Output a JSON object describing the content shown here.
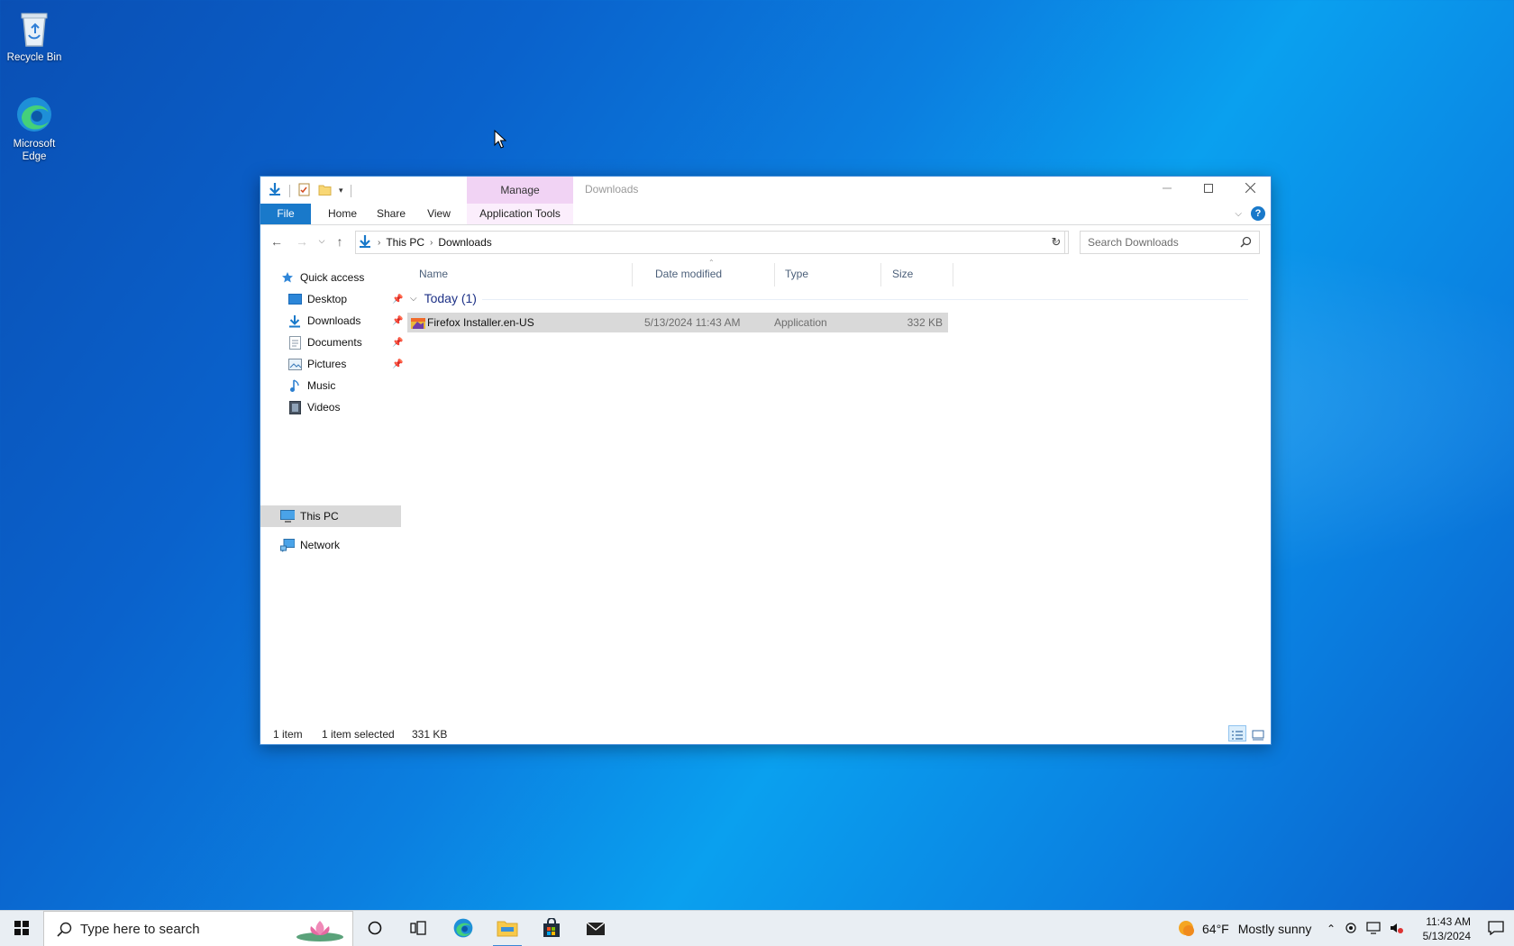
{
  "desktop": {
    "icons": [
      {
        "label": "Recycle Bin",
        "icon": "recycle-bin-icon"
      },
      {
        "label": "Microsoft Edge",
        "icon": "edge-icon"
      }
    ]
  },
  "window": {
    "title": "Downloads",
    "contextual_tab_group": "Manage",
    "tabs": [
      {
        "label": "File"
      },
      {
        "label": "Home"
      },
      {
        "label": "Share"
      },
      {
        "label": "View"
      },
      {
        "label": "Application Tools"
      }
    ],
    "address": {
      "crumbs": [
        "This PC",
        "Downloads"
      ]
    },
    "search": {
      "placeholder": "Search Downloads"
    },
    "nav": {
      "quick_access": "Quick access",
      "items": [
        {
          "label": "Desktop",
          "pinned": true,
          "icon": "desktop-folder-icon"
        },
        {
          "label": "Downloads",
          "pinned": true,
          "icon": "downloads-folder-icon"
        },
        {
          "label": "Documents",
          "pinned": true,
          "icon": "documents-folder-icon"
        },
        {
          "label": "Pictures",
          "pinned": true,
          "icon": "pictures-folder-icon"
        },
        {
          "label": "Music",
          "pinned": false,
          "icon": "music-folder-icon"
        },
        {
          "label": "Videos",
          "pinned": false,
          "icon": "videos-folder-icon"
        }
      ],
      "this_pc": "This PC",
      "network": "Network"
    },
    "columns": [
      "Name",
      "Date modified",
      "Type",
      "Size"
    ],
    "group": {
      "label": "Today (1)"
    },
    "files": [
      {
        "name": "Firefox Installer.en-US",
        "date_modified": "5/13/2024 11:43 AM",
        "type": "Application",
        "size": "332 KB"
      }
    ],
    "status": {
      "count": "1 item",
      "selected": "1 item selected",
      "selected_size": "331 KB"
    }
  },
  "taskbar": {
    "search_placeholder": "Type here to search",
    "weather": {
      "temp": "64°F",
      "condition": "Mostly sunny"
    },
    "clock": {
      "time": "11:43 AM",
      "date": "5/13/2024"
    }
  },
  "colors": {
    "accent": "#1979ca",
    "manage_tab": "#f1d3f4",
    "selection": "#d9d9d9"
  }
}
